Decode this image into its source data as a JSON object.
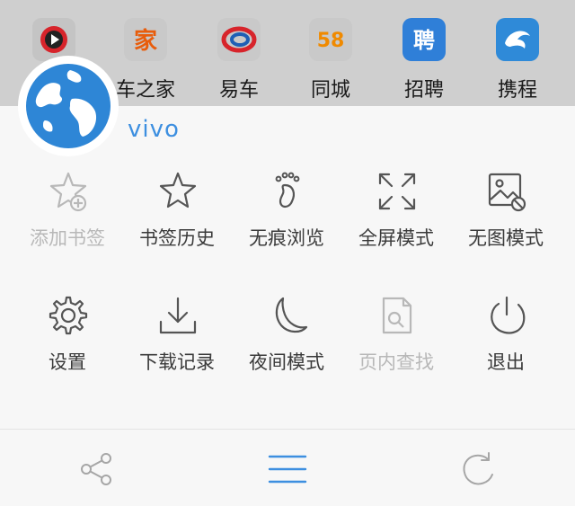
{
  "shortcuts": [
    {
      "label": "",
      "icon": "video-app-icon"
    },
    {
      "label": "车之家",
      "icon": "home-car-icon"
    },
    {
      "label": "易车",
      "icon": "easy-car-icon"
    },
    {
      "label": "同城",
      "icon": "58-city-icon"
    },
    {
      "label": "招聘",
      "icon": "recruit-icon"
    },
    {
      "label": "携程",
      "icon": "dolphin-travel-icon"
    }
  ],
  "shortcut_tile_texts": {
    "home": "家",
    "city": "58",
    "recruit": "聘"
  },
  "brand": {
    "name": "vivo"
  },
  "menu": {
    "row1": [
      {
        "label": "添加书签",
        "icon": "add-bookmark-icon",
        "enabled": false
      },
      {
        "label": "书签历史",
        "icon": "star-icon",
        "enabled": true
      },
      {
        "label": "无痕浏览",
        "icon": "footprint-icon",
        "enabled": true
      },
      {
        "label": "全屏模式",
        "icon": "fullscreen-icon",
        "enabled": true
      },
      {
        "label": "无图模式",
        "icon": "no-image-icon",
        "enabled": true
      }
    ],
    "row2": [
      {
        "label": "设置",
        "icon": "gear-icon",
        "enabled": true
      },
      {
        "label": "下载记录",
        "icon": "download-icon",
        "enabled": true
      },
      {
        "label": "夜间模式",
        "icon": "moon-icon",
        "enabled": true
      },
      {
        "label": "页内查找",
        "icon": "find-in-page-icon",
        "enabled": false
      },
      {
        "label": "退出",
        "icon": "power-icon",
        "enabled": true
      }
    ]
  },
  "bottom_bar": [
    {
      "icon": "share-icon"
    },
    {
      "icon": "menu-icon"
    },
    {
      "icon": "refresh-icon"
    }
  ],
  "colors": {
    "accent": "#3d8fe0",
    "icon": "#555555",
    "disabled": "#b8b8b8",
    "strip": "#cfcfcf",
    "panel": "#f7f7f7"
  }
}
